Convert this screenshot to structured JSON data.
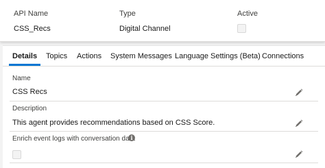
{
  "header": {
    "columns": [
      {
        "label": "API Name",
        "value": "CSS_Recs"
      },
      {
        "label": "Type",
        "value": "Digital Channel"
      },
      {
        "label": "Active",
        "checked": false
      }
    ]
  },
  "tabs": [
    {
      "label": "Details",
      "active": true
    },
    {
      "label": "Topics",
      "active": false
    },
    {
      "label": "Actions",
      "active": false
    },
    {
      "label": "System Messages",
      "active": false
    },
    {
      "label": "Language Settings (Beta)",
      "active": false
    },
    {
      "label": "Connections",
      "active": false
    }
  ],
  "fields": {
    "name": {
      "label": "Name",
      "value": "CSS Recs"
    },
    "description": {
      "label": "Description",
      "value": "This agent provides recommendations based on CSS Score."
    },
    "enrich": {
      "label": "Enrich event logs with conversation data",
      "checked": false
    }
  },
  "icons": {
    "edit": "pencil-icon",
    "info": "info-icon",
    "info_glyph": "i"
  },
  "colors": {
    "active_tab_accent": "#0176d3",
    "icon_gray": "#706e6b"
  }
}
